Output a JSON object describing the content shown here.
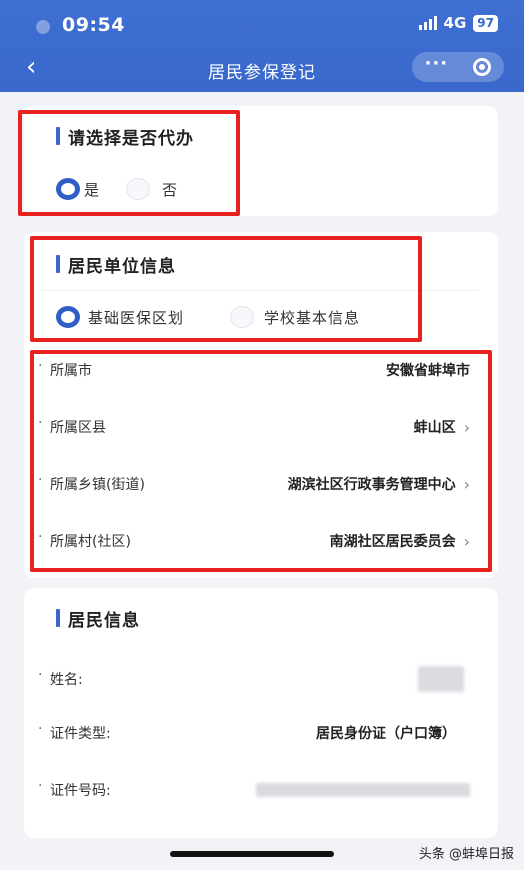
{
  "status": {
    "time": "09:54",
    "network": "4G",
    "battery": "97"
  },
  "nav": {
    "title": "居民参保登记",
    "back_icon": "chevron-left-icon",
    "more_icon": "more-icon",
    "close_icon": "target-icon"
  },
  "proxy": {
    "title": "请选择是否代办",
    "options": [
      "是",
      "否"
    ],
    "selected": "是"
  },
  "unit": {
    "title": "居民单位信息",
    "options": [
      "基础医保区划",
      "学校基本信息"
    ],
    "selected": "基础医保区划"
  },
  "region_rows": [
    {
      "label": "所属市",
      "value": "安徽省蚌埠市"
    },
    {
      "label": "所属区县",
      "value": "蚌山区"
    },
    {
      "label": "所属乡镇(街道)",
      "value": "湖滨社区行政事务管理中心"
    },
    {
      "label": "所属村(社区)",
      "value": "南湖社区居民委员会"
    }
  ],
  "resident": {
    "title": "居民信息",
    "name_label": "姓名:",
    "id_type_label": "证件类型:",
    "id_type_value": "居民身份证（户口簿）",
    "id_number_label": "证件号码:"
  },
  "watermark": "头条 @蚌埠日报",
  "colors": {
    "primary": "#3a68cc",
    "highlight": "#e8231f"
  }
}
